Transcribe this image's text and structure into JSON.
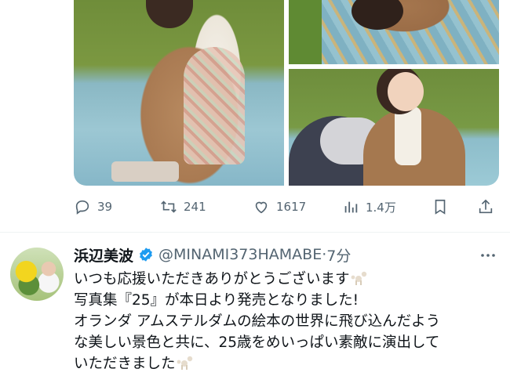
{
  "tweet_top": {
    "replies": "39",
    "retweets": "241",
    "likes": "1617",
    "views": "1.4万"
  },
  "tweet": {
    "author_name": "浜辺美波",
    "handle": "@MINAMI373HAMABE",
    "separator": "·",
    "time": "7分",
    "lines": [
      "いつも応援いただきありがとうございます",
      "写真集『25』が本日より発売となりました!",
      "オランダ アムステルダムの絵本の世界に飛び込んだよう",
      "な美しい景色と共に、25歳をめいっぱい素敵に演出して",
      "いただきました"
    ]
  },
  "colors": {
    "verified": "#1d9bf0",
    "muted": "#536471",
    "text": "#0f1419"
  },
  "icons": [
    "reply-icon",
    "retweet-icon",
    "like-icon",
    "views-icon",
    "bookmark-icon",
    "share-icon",
    "verified-badge-icon",
    "more-icon",
    "poodle-emoji-icon"
  ]
}
